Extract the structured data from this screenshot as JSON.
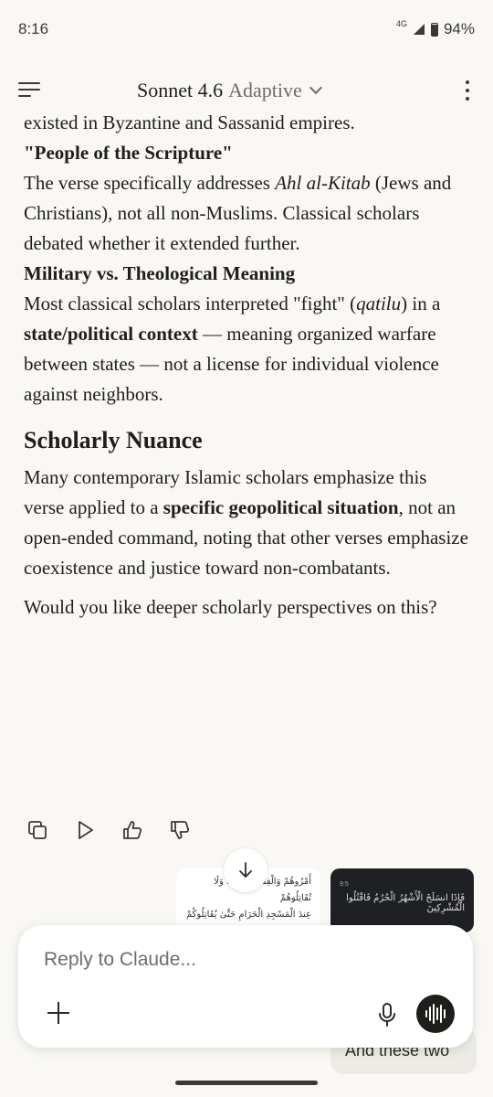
{
  "status": {
    "time": "8:16",
    "network": "4G",
    "battery": "94%"
  },
  "header": {
    "model": "Sonnet 4.6",
    "mode": "Adaptive"
  },
  "message": {
    "intro_line": "existed in Byzantine and Sassanid empires.",
    "sec1_title": "\"People of the Scripture\"",
    "sec1_a": "The verse specifically addresses ",
    "sec1_em": "Ahl al-Kitab",
    "sec1_b": " (Jews and Christians), not all non-Muslims. Classical scholars debated whether it extended further.",
    "sec2_title": "Military vs. Theological Meaning",
    "sec2_a": "Most classical scholars interpreted \"fight\" (",
    "sec2_em": "qatilu",
    "sec2_b": ") in a ",
    "sec2_bold": "state/political context",
    "sec2_c": " — meaning organized warfare between states — not a license for individual violence against neighbors.",
    "h2": "Scholarly Nuance",
    "p1_a": "Many contemporary Islamic scholars emphasize this verse applied to a ",
    "p1_bold": "specific geopolitical situation",
    "p1_b": ", not an open-ended command, noting that other verses emphasize coexistence and justice toward non-combatants.",
    "p2": "Would you like deeper scholarly perspectives on this?"
  },
  "actions": [
    "copy-icon",
    "play-icon",
    "thumbs-up-icon",
    "thumbs-down-icon"
  ],
  "attachments": {
    "thumb1_lines": [
      "أَمْرُوهُمْ وَالْفِتْنَةُ أَشَدُّ ... وَلَا تُقَاتِلُوهُمْ",
      "عِندَ الْمَسْجِدِ الْحَرَامِ حَتَّىٰ يُقَاتِلُوكُمْ فِيهِ"
    ],
    "thumb2_top": "9:5",
    "thumb2_line": "فَإِذَا انسَلَخَ الْأَشْهُرُ الْحُرُمُ فَاقْتُلُوا الْمُشْرِكِينَ"
  },
  "user_message": "And these two",
  "composer": {
    "placeholder": "Reply to Claude..."
  }
}
